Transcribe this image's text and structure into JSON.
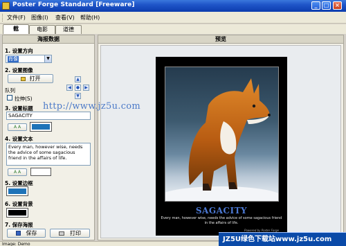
{
  "window": {
    "title": "Poster Forge Standard [Freeware]"
  },
  "menu": [
    "文件(F)",
    "图像(I)",
    "查看(V)",
    "帮助(H)"
  ],
  "tabs": [
    "截",
    "电影",
    "道德"
  ],
  "left_panel": {
    "header": "海报数据",
    "sections": {
      "orientation": {
        "label": "1. 设置方向",
        "value": "肖像"
      },
      "image": {
        "label": "2. 设置图像",
        "open_button": "打开",
        "queue_label": "队列",
        "stretch_label": "拉伸(S)"
      },
      "title": {
        "label": "3. 设置标题",
        "value": "SAGACITY",
        "font_button": "A A"
      },
      "text": {
        "label": "4. 设置文本",
        "value": "Every man, however wise, needs the advice of some sagacious friend in the affairs of life.",
        "font_button": "A A"
      },
      "border": {
        "label": "5. 设置边框"
      },
      "background": {
        "label": "6. 设置背景"
      },
      "save": {
        "label": "7. 保存海报",
        "save_button": "保存",
        "print_button": "打印"
      }
    }
  },
  "preview": {
    "header": "预览",
    "poster_title": "SAGACITY",
    "poster_text": "Every man, however wise, needs the advice of some sagacious friend in the affairs of life.",
    "poster_credit": "Powered by Poster Forge"
  },
  "watermark": "http://www.jz5u.com",
  "status": {
    "text": "Image: Demo"
  },
  "badge": {
    "text": "JZ5U绿色下载站www.jz5u.com"
  },
  "colors": {
    "title_color": "#1e73b8",
    "border_color": "#1e73b8",
    "background_color": "#000000",
    "titlebar": "#0b3cae"
  }
}
